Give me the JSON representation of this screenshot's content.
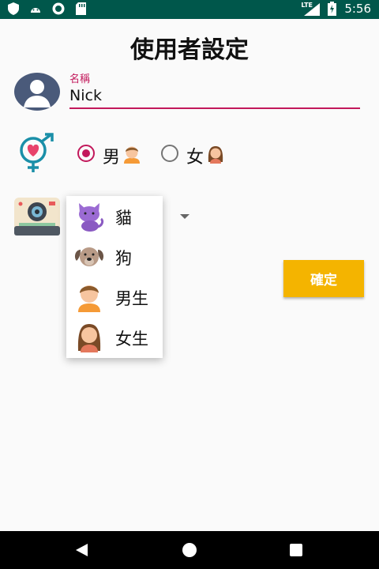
{
  "status_bar": {
    "time": "5:56",
    "network": "LTE",
    "icons": [
      "shield-icon",
      "android-icon",
      "disc-icon",
      "sd-card-icon",
      "signal-icon",
      "battery-icon"
    ]
  },
  "page": {
    "title": "使用者設定"
  },
  "name_field": {
    "label": "名稱",
    "value": "Nick"
  },
  "gender": {
    "options": [
      {
        "label": "男",
        "selected": true,
        "icon": "boy-face-icon"
      },
      {
        "label": "女",
        "selected": false,
        "icon": "girl-face-icon"
      }
    ]
  },
  "photo_menu": {
    "items": [
      {
        "label": "貓",
        "icon": "cat-icon"
      },
      {
        "label": "狗",
        "icon": "dog-icon"
      },
      {
        "label": "男生",
        "icon": "boy-icon"
      },
      {
        "label": "女生",
        "icon": "girl-icon"
      }
    ]
  },
  "confirm": {
    "label": "確定"
  },
  "colors": {
    "accent": "#c2185b",
    "status_bar": "#00574b",
    "button": "#f4b400"
  }
}
